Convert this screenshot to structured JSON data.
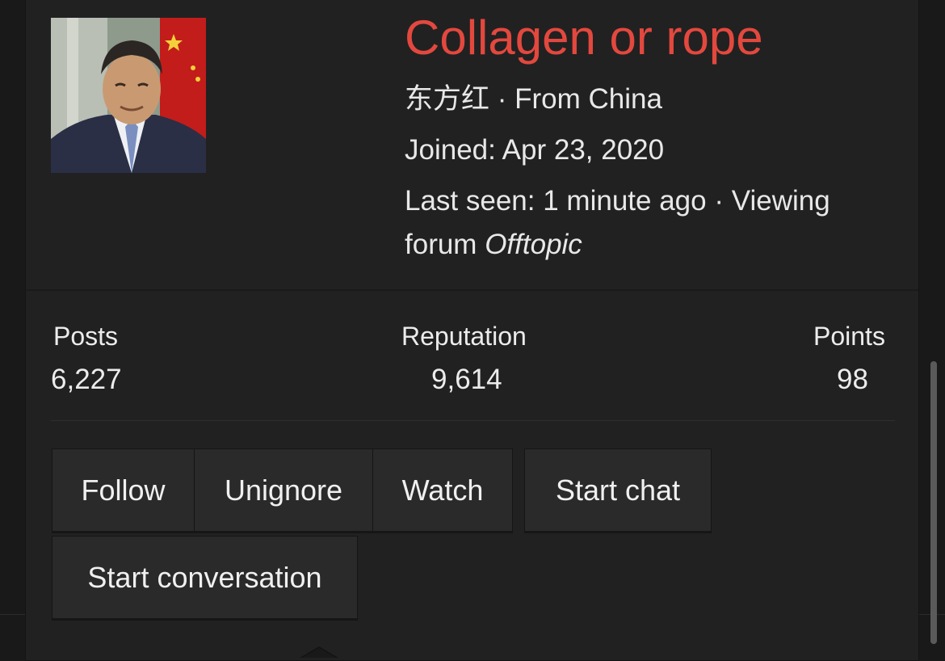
{
  "profile": {
    "username": "Collagen or rope",
    "user_title": "东方红",
    "location": "From China",
    "joined_label": "Joined:",
    "joined_date": "Apr 23, 2020",
    "last_seen_label": "Last seen:",
    "last_seen_time": "1 minute ago",
    "activity": "Viewing forum",
    "activity_forum": "Offtopic",
    "separator": "·"
  },
  "stats": {
    "posts_label": "Posts",
    "posts_value": "6,227",
    "reputation_label": "Reputation",
    "reputation_value": "9,614",
    "points_label": "Points",
    "points_value": "98"
  },
  "actions": {
    "follow": "Follow",
    "unignore": "Unignore",
    "watch": "Watch",
    "start_chat": "Start chat",
    "start_conversation": "Start conversation"
  },
  "colors": {
    "username": "#e3483e",
    "background": "#191919",
    "card": "#212121",
    "button": "#2a2a2a"
  }
}
